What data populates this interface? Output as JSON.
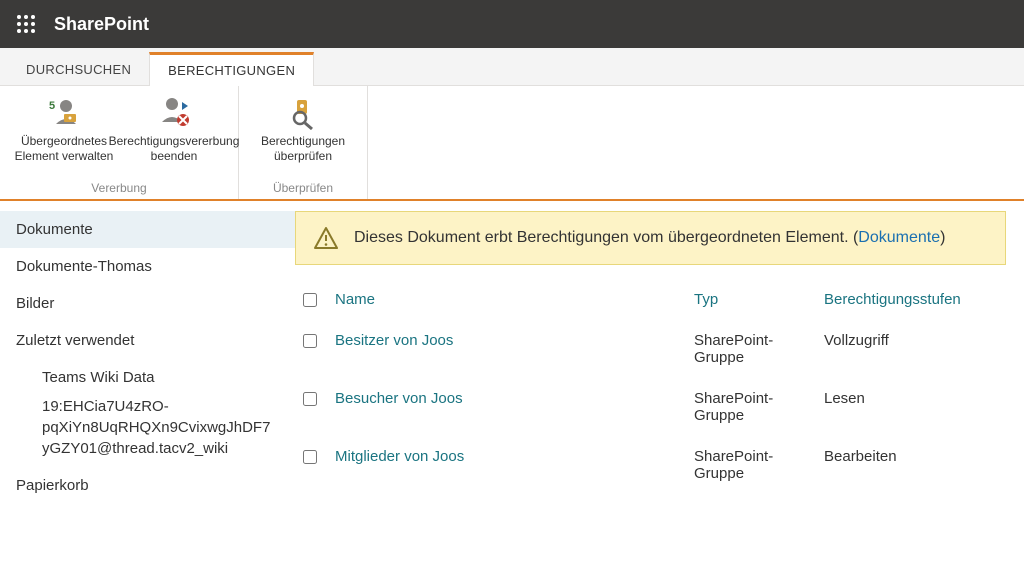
{
  "brand": "SharePoint",
  "tabs": {
    "browse": "DURCHSUCHEN",
    "permissions": "BERECHTIGUNGEN"
  },
  "ribbon": {
    "inherit_group": {
      "btn_manage_parent": "Übergeordnetes Element verwalten",
      "btn_stop_inherit": "Berechtigungsvererbung beenden",
      "title": "Vererbung"
    },
    "check_group": {
      "btn_check_perm": "Berechtigungen überprüfen",
      "title": "Überprüfen"
    }
  },
  "sidebar": {
    "items": {
      "docs": "Dokumente",
      "docs_thomas": "Dokumente-Thomas",
      "pictures": "Bilder",
      "recent": "Zuletzt verwendet",
      "recycle": "Papierkorb"
    },
    "recent_children": {
      "wiki": "Teams Wiki Data",
      "thread": "19:EHCia7U4zRO-pqXiYn8UqRHQXn9CvixwgJhDF7yGZY01@thread.tacv2_wiki"
    }
  },
  "notice": {
    "text_prefix": "Dieses Dokument erbt Berechtigungen vom übergeordneten Element. (",
    "link": "Dokumente",
    "text_suffix": ")"
  },
  "table": {
    "headers": {
      "name": "Name",
      "type": "Typ",
      "level": "Berechtigungsstufen"
    },
    "rows": [
      {
        "name": "Besitzer von Joos",
        "type": "SharePoint-Gruppe",
        "level": "Vollzugriff"
      },
      {
        "name": "Besucher von Joos",
        "type": "SharePoint-Gruppe",
        "level": "Lesen"
      },
      {
        "name": "Mitglieder von Joos",
        "type": "SharePoint-Gruppe",
        "level": "Bearbeiten"
      }
    ]
  }
}
